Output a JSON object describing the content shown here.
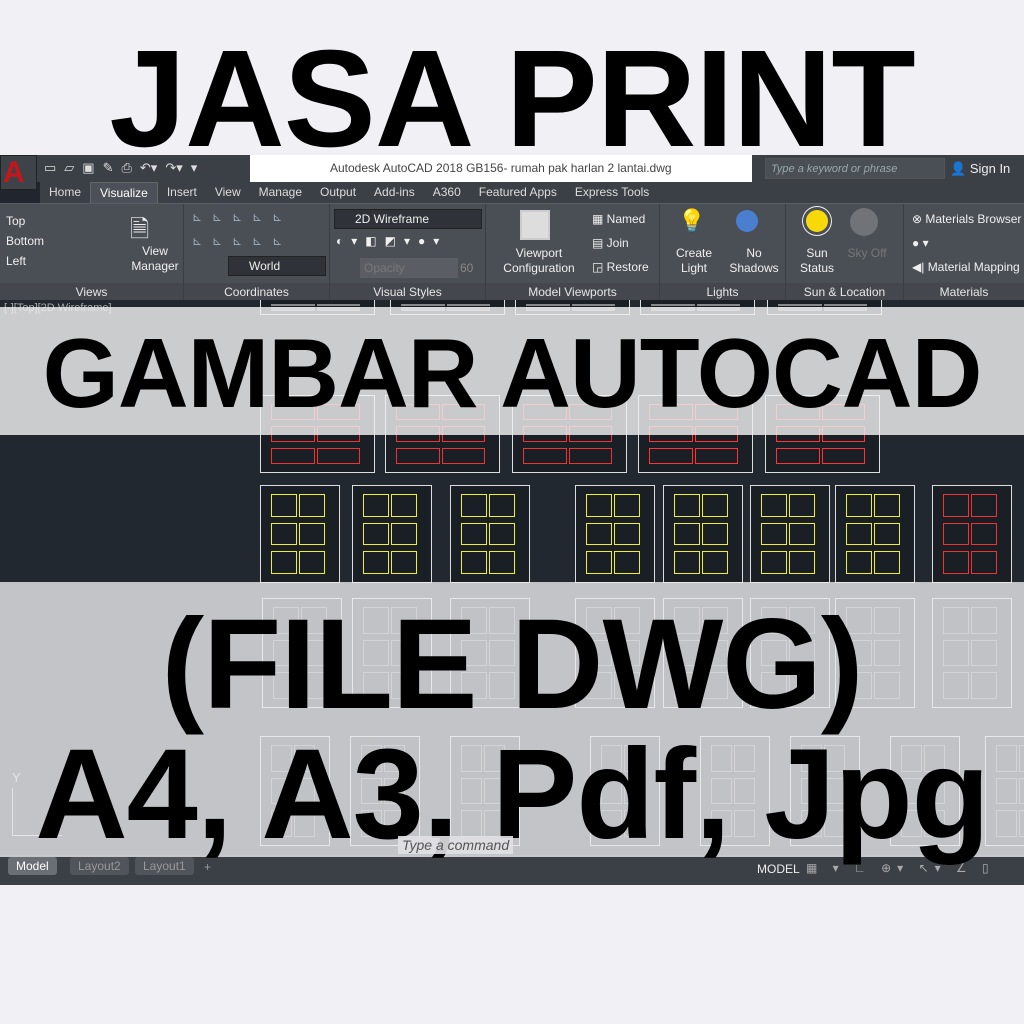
{
  "headlines": {
    "line1": "JASA PRINT",
    "line2": "GAMBAR AUTOCAD",
    "line3": "(FILE DWG)",
    "line4": "A4, A3, Pdf, Jpg"
  },
  "app": {
    "logo": "A",
    "title": "Autodesk AutoCAD 2018    GB156- rumah pak harlan 2 lantai.dwg",
    "search_placeholder": "Type a keyword or phrase",
    "sign_in": "Sign In",
    "tabs": [
      "Home",
      "Visualize",
      "Insert",
      "View",
      "Manage",
      "Output",
      "Add-ins",
      "A360",
      "Featured Apps",
      "Express Tools"
    ],
    "active_tab": "Visualize",
    "ribbon": {
      "views": {
        "label": "Views",
        "items": [
          "Top",
          "Bottom",
          "Left"
        ],
        "view_manager": "View Manager"
      },
      "coordinates": {
        "label": "Coordinates",
        "ucs": "World"
      },
      "visual_styles": {
        "label": "Visual Styles",
        "style": "2D Wireframe",
        "opacity_label": "Opacity",
        "opacity_value": "60"
      },
      "model_viewports": {
        "label": "Model Viewports",
        "config": "Viewport Configuration",
        "named": "Named",
        "join": "Join",
        "restore": "Restore"
      },
      "lights": {
        "label": "Lights",
        "create": "Create Light",
        "shadows": "No Shadows"
      },
      "sun": {
        "label": "Sun & Location",
        "status": "Sun Status",
        "sky": "Sky Off"
      },
      "materials": {
        "label": "Materials",
        "browser": "Materials Browser",
        "mapping": "Material Mapping"
      }
    },
    "viewport_label": "[-][Top][2D Wireframe]",
    "command_placeholder": "Type a command",
    "layout_tabs": [
      "Model",
      "Layout2",
      "Layout1"
    ],
    "status_mode": "MODEL",
    "colors": {
      "accent": "#c8151b",
      "viewport": "#212830",
      "ribbon": "#4a4e55"
    }
  }
}
